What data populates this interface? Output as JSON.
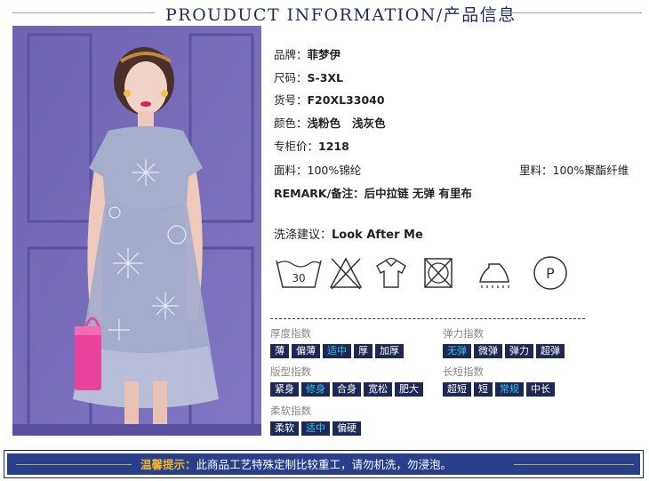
{
  "header": {
    "title": "PROUDUCT INFORMATION/产品信息"
  },
  "product": {
    "brand_label": "品牌：",
    "brand": "菲梦伊",
    "size_label": "尺码：",
    "size": "S-3XL",
    "sku_label": "货号：",
    "sku": "F20XL33040",
    "color_label": "颜色：",
    "color": "浅粉色   浅灰色",
    "price_label": "专柜价：",
    "price": "1218",
    "fabric_label": "面料：",
    "fabric": "100%锦纶",
    "lining_label": "里料：",
    "lining": "100%聚酯纤维",
    "remark_label": "REMARK/备注：",
    "remark": "后中拉链 无弹 有里布",
    "wash_label": "洗涤建议：",
    "wash": "Look After Me"
  },
  "care_icons": [
    {
      "icon": "wash-30-icon",
      "text": "30"
    },
    {
      "icon": "no-bleach-icon"
    },
    {
      "icon": "hang-dry-icon"
    },
    {
      "icon": "no-tumble-dry-icon"
    },
    {
      "icon": "iron-icon"
    },
    {
      "icon": "dry-clean-p-icon",
      "text": "P"
    }
  ],
  "indices": {
    "thickness": {
      "title": "厚度指数",
      "options": [
        "薄",
        "偏薄",
        "适中",
        "厚",
        "加厚"
      ],
      "selected": "适中"
    },
    "elasticity": {
      "title": "弹力指数",
      "options": [
        "无弹",
        "微弹",
        "弹力",
        "超弹"
      ],
      "selected": "无弹"
    },
    "fit": {
      "title": "版型指数",
      "options": [
        "紧身",
        "修身",
        "合身",
        "宽松",
        "肥大"
      ],
      "selected": "修身"
    },
    "length": {
      "title": "长短指数",
      "options": [
        "超短",
        "短",
        "常规",
        "中长"
      ],
      "selected": "常规"
    },
    "softness": {
      "title": "柔软指数",
      "options": [
        "柔软",
        "适中",
        "偏硬"
      ],
      "selected": "适中"
    }
  },
  "footer": {
    "label": "温馨提示：",
    "text": "此商品工艺特殊定制比较重工，请勿机洗，勿浸泡。"
  },
  "colors": {
    "navy": "#1d2954",
    "active_text": "#35c3ea",
    "footer_bg": "#283f8a",
    "footer_label": "#f0b32e",
    "backdrop": "#7468b6",
    "dress": "#a6aecb"
  }
}
